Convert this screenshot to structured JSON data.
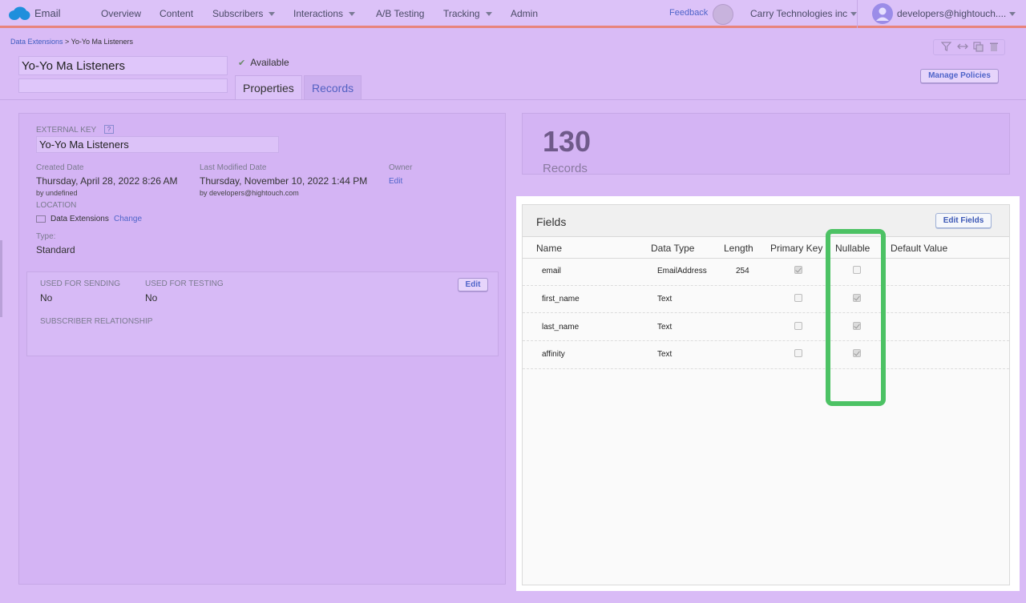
{
  "topnav": {
    "app_name": "Email",
    "items": [
      "Overview",
      "Content",
      "Subscribers",
      "Interactions",
      "A/B Testing",
      "Tracking",
      "Admin"
    ],
    "feedback": "Feedback",
    "org": "Carry Technologies inc",
    "user": "developers@hightouch...."
  },
  "breadcrumb": {
    "root": "Data Extensions",
    "sep": " > ",
    "current": "Yo-Yo Ma Listeners"
  },
  "header": {
    "name_value": "Yo-Yo Ma Listeners",
    "status": "Available",
    "tabs": [
      "Properties",
      "Records"
    ],
    "manage_policies": "Manage Policies"
  },
  "properties": {
    "external_key_label": "EXTERNAL KEY",
    "help": "?",
    "external_key_value": "Yo-Yo Ma Listeners",
    "created_label": "Created Date",
    "created_value": "Thursday, April 28, 2022 8:26 AM",
    "created_by": "by undefined",
    "modified_label": "Last Modified Date",
    "modified_value": "Thursday, November 10, 2022 1:44 PM",
    "modified_by": "by developers@hightouch.com",
    "owner_label": "Owner",
    "owner_edit": "Edit",
    "location_label": "LOCATION",
    "location_value": "Data Extensions",
    "location_change": "Change",
    "type_label": "Type:",
    "type_value": "Standard",
    "sending_label": "USED FOR SENDING",
    "sending_value": "No",
    "testing_label": "USED FOR TESTING",
    "testing_value": "No",
    "usage_edit": "Edit",
    "subscriber_rel_label": "SUBSCRIBER RELATIONSHIP"
  },
  "records": {
    "count": "130",
    "label": "Records"
  },
  "fields": {
    "title": "Fields",
    "edit_button": "Edit Fields",
    "columns": [
      "Name",
      "Data Type",
      "Length",
      "Primary Key",
      "Nullable",
      "Default Value"
    ],
    "rows": [
      {
        "name": "email",
        "type": "EmailAddress",
        "length": "254",
        "primary_key": true,
        "nullable": false
      },
      {
        "name": "first_name",
        "type": "Text",
        "length": "",
        "primary_key": false,
        "nullable": true
      },
      {
        "name": "last_name",
        "type": "Text",
        "length": "",
        "primary_key": false,
        "nullable": true
      },
      {
        "name": "affinity",
        "type": "Text",
        "length": "",
        "primary_key": false,
        "nullable": true
      }
    ]
  },
  "colors": {
    "highlight": "#4cc264",
    "link": "#4f64c9",
    "nav_border": "#e8847c"
  }
}
